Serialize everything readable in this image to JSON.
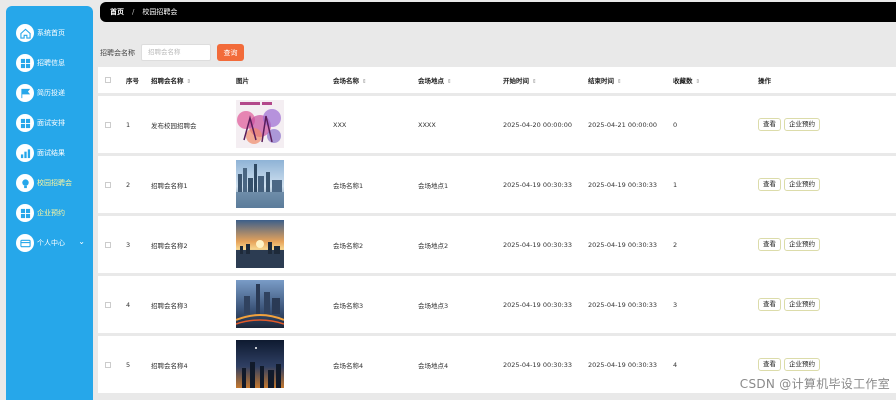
{
  "sidebar": {
    "items": [
      {
        "label": "系统首页",
        "icon": "home-icon"
      },
      {
        "label": "招聘信息",
        "icon": "grid-icon"
      },
      {
        "label": "简历投递",
        "icon": "flag-icon"
      },
      {
        "label": "面试安排",
        "icon": "grid-icon"
      },
      {
        "label": "面试结果",
        "icon": "chart-icon"
      },
      {
        "label": "校园招聘会",
        "icon": "bulb-icon"
      },
      {
        "label": "企业预约",
        "icon": "grid-icon"
      },
      {
        "label": "个人中心",
        "icon": "card-icon"
      }
    ]
  },
  "breadcrumb": {
    "home": "首页",
    "sep": "/",
    "current": "校园招聘会"
  },
  "search": {
    "label": "招聘会名称",
    "placeholder": "招聘会名称",
    "button": "查询"
  },
  "table": {
    "headers": {
      "no": "序号",
      "name": "招聘会名称",
      "image": "图片",
      "venue": "会场名称",
      "place": "会场地点",
      "start": "开始时间",
      "end": "结束时间",
      "fav": "收藏数",
      "op": "操作"
    },
    "rows": [
      {
        "no": "1",
        "name": "发布校园招聘会",
        "venue": "XXX",
        "place": "XXXX",
        "start": "2025-04-20 00:00:00",
        "end": "2025-04-21 00:00:00",
        "fav": "0"
      },
      {
        "no": "2",
        "name": "招聘会名称1",
        "venue": "会场名称1",
        "place": "会场地点1",
        "start": "2025-04-19 00:30:33",
        "end": "2025-04-19 00:30:33",
        "fav": "1"
      },
      {
        "no": "3",
        "name": "招聘会名称2",
        "venue": "会场名称2",
        "place": "会场地点2",
        "start": "2025-04-19 00:30:33",
        "end": "2025-04-19 00:30:33",
        "fav": "2"
      },
      {
        "no": "4",
        "name": "招聘会名称3",
        "venue": "会场名称3",
        "place": "会场地点3",
        "start": "2025-04-19 00:30:33",
        "end": "2025-04-19 00:30:33",
        "fav": "3"
      },
      {
        "no": "5",
        "name": "招聘会名称4",
        "venue": "会场名称4",
        "place": "会场地点4",
        "start": "2025-04-19 00:30:33",
        "end": "2025-04-19 00:30:33",
        "fav": "4"
      }
    ],
    "actions": {
      "view": "查看",
      "reserve": "企业预约"
    }
  },
  "watermark": "CSDN @计算机毕设工作室",
  "colors": {
    "sidebar": "#26a7ea",
    "accent": "#f26b3a",
    "active_text": "#fff7a0"
  }
}
